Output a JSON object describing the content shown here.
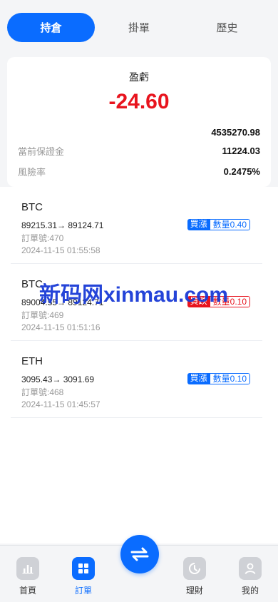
{
  "tabs": [
    "持倉",
    "掛單",
    "歷史"
  ],
  "summary": {
    "pl_label": "盈虧",
    "pl_value": "-24.60",
    "total_value": "4535270.98",
    "margin_label": "當前保證金",
    "margin_value": "11224.03",
    "risk_label": "風險率",
    "risk_value": "0.2475%"
  },
  "orders": [
    {
      "symbol": "BTC",
      "price": "89215.31→ 89124.71",
      "order_no": "訂單號:470",
      "time": "2024-11-15 01:55:58",
      "side": "買漲",
      "qty": "數量0.40",
      "color": "blue"
    },
    {
      "symbol": "BTC",
      "price": "89004.55→ 89124.71",
      "order_no": "訂單號:469",
      "time": "2024-11-15 01:51:16",
      "side": "買跌",
      "qty": "數量0.10",
      "color": "red"
    },
    {
      "symbol": "ETH",
      "price": "3095.43→ 3091.69",
      "order_no": "訂單號:468",
      "time": "2024-11-15 01:45:57",
      "side": "買漲",
      "qty": "數量0.10",
      "color": "blue"
    }
  ],
  "watermark": "新码网xinmau.com",
  "nav": {
    "home": "首頁",
    "orders": "訂單",
    "finance": "理財",
    "mine": "我的"
  },
  "colors": {
    "accent": "#0a6cff",
    "loss": "#e8141e",
    "muted": "#999999"
  }
}
